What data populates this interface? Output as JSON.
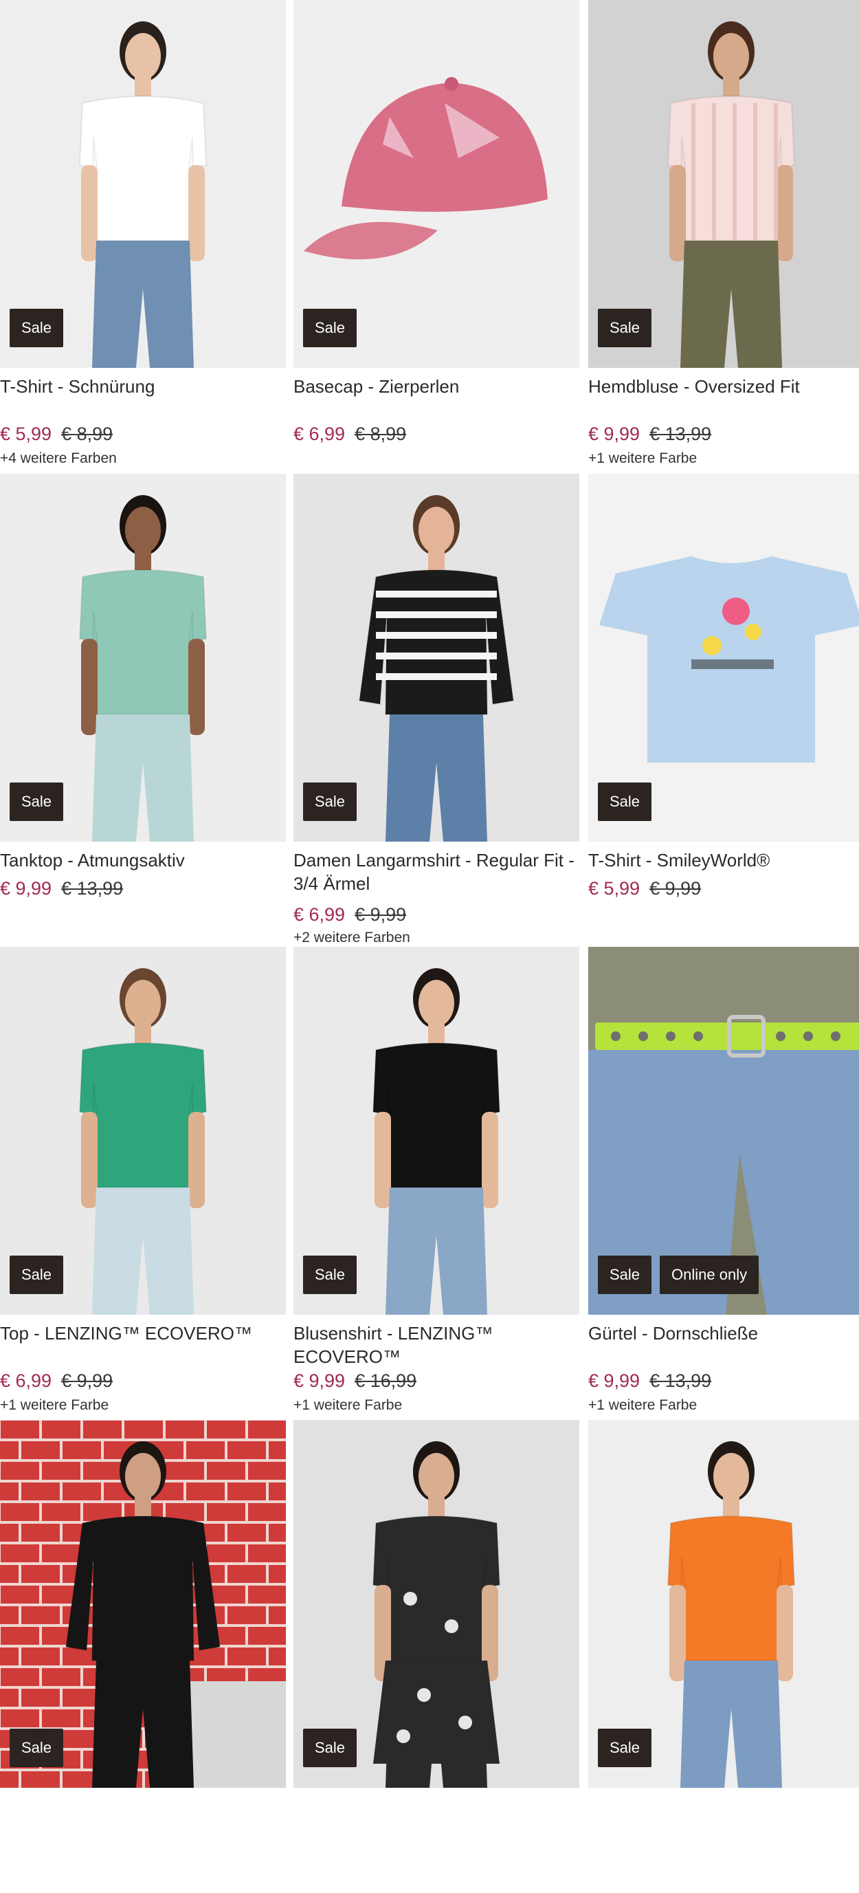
{
  "products": [
    {
      "title": "T-Shirt - Schnürung",
      "price": "€ 5,99",
      "old_price": "€ 8,99",
      "colors": "+4 weitere Farben",
      "badges": [
        "Sale"
      ]
    },
    {
      "title": "Basecap - Zierperlen",
      "price": "€ 6,99",
      "old_price": "€ 8,99",
      "colors": "",
      "badges": [
        "Sale"
      ]
    },
    {
      "title": "Hemdbluse - Oversized Fit",
      "price": "€ 9,99",
      "old_price": "€ 13,99",
      "colors": "+1 weitere Farbe",
      "badges": [
        "Sale"
      ]
    },
    {
      "title": "Tanktop - Atmungsaktiv",
      "price": "€ 9,99",
      "old_price": "€ 13,99",
      "colors": "",
      "badges": [
        "Sale"
      ]
    },
    {
      "title": "Damen Langarmshirt - Regular Fit - 3/4 Ärmel",
      "price": "€ 6,99",
      "old_price": "€ 9,99",
      "colors": "+2 weitere Farben",
      "badges": [
        "Sale"
      ]
    },
    {
      "title": "T-Shirt - SmileyWorld®",
      "price": "€ 5,99",
      "old_price": "€ 9,99",
      "colors": "",
      "badges": [
        "Sale"
      ]
    },
    {
      "title": "Top - LENZING™ ECOVERO™",
      "price": "€ 6,99",
      "old_price": "€ 9,99",
      "colors": "+1 weitere Farbe",
      "badges": [
        "Sale"
      ]
    },
    {
      "title": "Blusenshirt - LENZING™ ECOVERO™",
      "price": "€ 9,99",
      "old_price": "€ 16,99",
      "colors": "+1 weitere Farbe",
      "badges": [
        "Sale"
      ]
    },
    {
      "title": "Gürtel - Dornschließe",
      "price": "€ 9,99",
      "old_price": "€ 13,99",
      "colors": "+1 weitere Farbe",
      "badges": [
        "Sale",
        "Online only"
      ]
    },
    {
      "title": "",
      "price": "",
      "old_price": "",
      "colors": "",
      "badges": [
        "Sale"
      ]
    },
    {
      "title": "",
      "price": "",
      "old_price": "",
      "colors": "",
      "badges": [
        "Sale"
      ]
    },
    {
      "title": "",
      "price": "",
      "old_price": "",
      "colors": "",
      "badges": [
        "Sale"
      ]
    }
  ],
  "images": [
    {
      "icon": "white-tshirt-model-photo",
      "bg": "#eeeeee",
      "garment": "#ffffff",
      "pants": "#6f8fb3",
      "skin": "#e8c2a6",
      "hair": "#2a211c"
    },
    {
      "icon": "pink-basecap-photo",
      "bg": "#efefef",
      "garment": "#d86f86"
    },
    {
      "icon": "striped-blouse-model-photo",
      "bg": "#d2d2d2",
      "garment": "#f5dedb",
      "pants": "#6b6a4c",
      "skin": "#d6a98b",
      "hair": "#4a2c1e"
    },
    {
      "icon": "green-tanktop-model-photo",
      "bg": "#ededed",
      "garment": "#8fc8b6",
      "pants": "#b9d6d6",
      "skin": "#8d5f45",
      "hair": "#1a1411"
    },
    {
      "icon": "striped-longsleeve-model-photo",
      "bg": "#e4e4e4",
      "garment": "#1b1b1b",
      "pants": "#5d80a8",
      "skin": "#e3b497",
      "hair": "#5a3b28"
    },
    {
      "icon": "smiley-tshirt-photo",
      "bg": "#f2f2f2",
      "garment": "#b9d4ec"
    },
    {
      "icon": "green-top-model-photo",
      "bg": "#e9e9e9",
      "garment": "#2fa57c",
      "pants": "#c9dbe3",
      "skin": "#ddb08f",
      "hair": "#6a4630"
    },
    {
      "icon": "black-blouse-model-photo",
      "bg": "#eaeaea",
      "garment": "#121212",
      "pants": "#8aa7c7",
      "skin": "#e3b89b",
      "hair": "#1e1714"
    },
    {
      "icon": "green-belt-photo",
      "bg": "#8b8d76",
      "garment": "#b5e23b",
      "pants": "#7f9fc4"
    },
    {
      "icon": "black-outfit-brick-wall-photo",
      "bg": "#d9413f",
      "garment": "#151515",
      "pants": "#151515",
      "skin": "#cf9f83",
      "hair": "#1c1512"
    },
    {
      "icon": "floral-dress-model-photo",
      "bg": "#e1e1e1",
      "garment": "#2a2a2a",
      "pants": "#2a2a2a",
      "skin": "#d9ad90",
      "hair": "#1c1512"
    },
    {
      "icon": "orange-tshirt-model-photo",
      "bg": "#eeeeee",
      "garment": "#f47a27",
      "pants": "#7c9cc2",
      "skin": "#e3b89b",
      "hair": "#211915"
    }
  ]
}
